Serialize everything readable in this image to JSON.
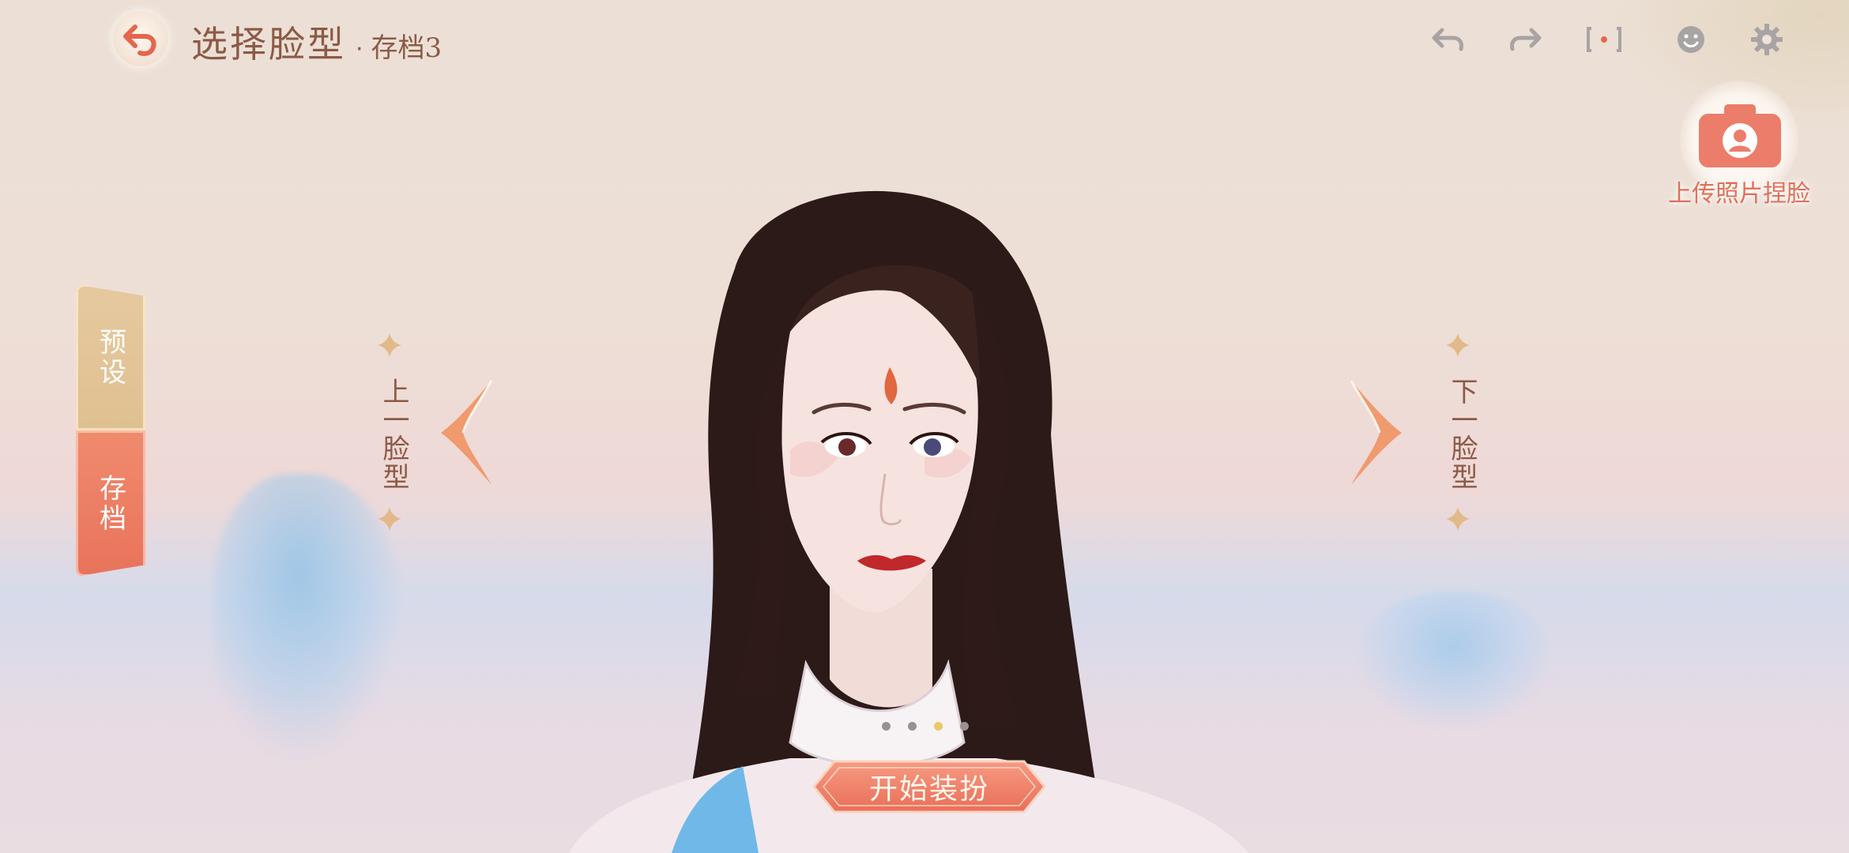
{
  "header": {
    "title": "选择脸型",
    "separator": "·",
    "slot": "存档3"
  },
  "toolbar": {
    "undo_icon": "undo-arrow-icon",
    "redo_icon": "redo-arrow-icon",
    "screenshot_icon": "screenshot-frame-icon",
    "expression_icon": "smiley-face-icon",
    "settings_icon": "gear-icon"
  },
  "upload": {
    "label": "上传照片捏脸",
    "icon": "camera-icon"
  },
  "side_tabs": [
    {
      "label": "预设"
    },
    {
      "label": "存档"
    }
  ],
  "navigation": {
    "prev_label": "上一脸型",
    "next_label": "下一脸型"
  },
  "pager": {
    "total": 4,
    "active_index": 2
  },
  "start_button": {
    "label": "开始装扮"
  },
  "colors": {
    "accent": "#e8735a",
    "title_brown": "#8c5a46",
    "gold": "#e6c9a0",
    "icon_gray": "#a8a4a4"
  }
}
